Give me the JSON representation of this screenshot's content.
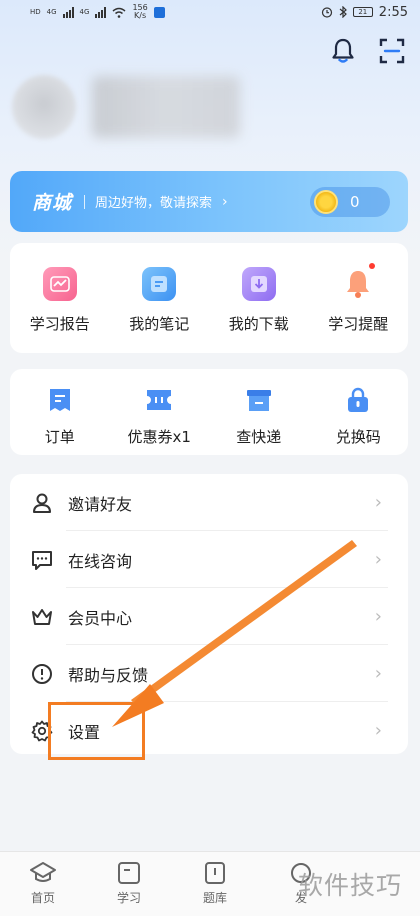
{
  "status_bar": {
    "net_label_1": "HD",
    "net_label_2": "4G",
    "net_label_3": "4G",
    "speed_value": "156",
    "speed_unit": "K/s",
    "battery": "21",
    "time": "2:55"
  },
  "header": {
    "bell_icon": "bell-icon",
    "scan_icon": "scan-icon"
  },
  "mall": {
    "title": "商城",
    "subtitle": "周边好物，敬请探索",
    "arrow": "›",
    "coin_count": "0"
  },
  "quick_grid": [
    {
      "label": "学习报告",
      "icon": "chart-icon",
      "color": "#fb6f9a"
    },
    {
      "label": "我的笔记",
      "icon": "note-icon",
      "color": "#4ba5f7"
    },
    {
      "label": "我的下载",
      "icon": "download-icon",
      "color": "#9c7cf4"
    },
    {
      "label": "学习提醒",
      "icon": "bell-icon",
      "color": "#fb9a6c"
    }
  ],
  "service_grid": [
    {
      "label": "订单",
      "icon": "order-icon"
    },
    {
      "label": "优惠券x1",
      "icon": "coupon-icon"
    },
    {
      "label": "查快递",
      "icon": "express-icon"
    },
    {
      "label": "兑换码",
      "icon": "redeem-icon"
    }
  ],
  "menu": [
    {
      "label": "邀请好友",
      "icon": "user-icon"
    },
    {
      "label": "在线咨询",
      "icon": "chat-icon"
    },
    {
      "label": "会员中心",
      "icon": "crown-icon"
    },
    {
      "label": "帮助与反馈",
      "icon": "help-icon"
    },
    {
      "label": "设置",
      "icon": "gear-icon"
    }
  ],
  "bottom_nav": [
    {
      "label": "首页",
      "icon": "home-icon"
    },
    {
      "label": "学习",
      "icon": "study-icon"
    },
    {
      "label": "题库",
      "icon": "question-bank-icon"
    },
    {
      "label": "发",
      "icon": "discover-icon"
    }
  ],
  "watermark": "软件技巧",
  "colors": {
    "accent": "#4a9cf6",
    "annotation": "#f37c22"
  }
}
